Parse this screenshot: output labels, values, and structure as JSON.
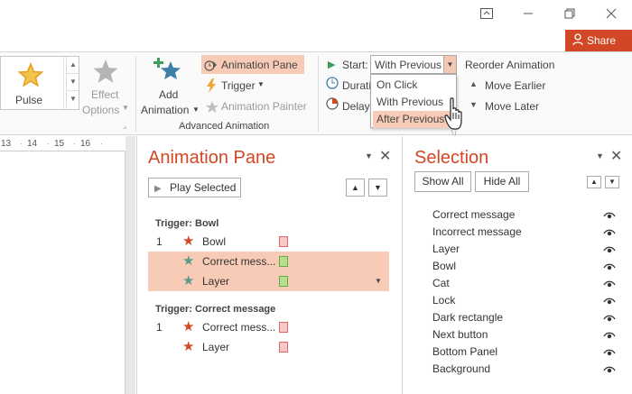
{
  "window": {
    "share_label": "Share",
    "colors": {
      "accent": "#d24726",
      "highlight": "#f8cbb6"
    }
  },
  "ribbon": {
    "gallery": {
      "selected_effect": "Pulse"
    },
    "effect_options": {
      "line1": "Effect",
      "line2": "Options"
    },
    "add_animation": {
      "line1": "Add",
      "line2": "Animation"
    },
    "animation_pane_btn": "Animation Pane",
    "trigger_btn": "Trigger",
    "animation_painter_btn": "Animation Painter",
    "group_label": "Advanced Animation",
    "start_label": "Start:",
    "duration_label": "Duratio",
    "delay_label": "Delay:",
    "start_value": "With Previous",
    "start_options": [
      "On Click",
      "With Previous",
      "After Previous"
    ],
    "reorder_label": "Reorder Animation",
    "move_earlier": "Move Earlier",
    "move_later": "Move Later"
  },
  "ruler": {
    "ticks": [
      "13",
      "14",
      "15",
      "16"
    ]
  },
  "animation_pane": {
    "title": "Animation Pane",
    "play_selected": "Play Selected",
    "groups": [
      {
        "trigger": "Trigger: Bowl",
        "items": [
          {
            "num": "1",
            "name": "Bowl",
            "star": "#d24726",
            "box": "red"
          },
          {
            "num": "",
            "name": "Correct mess...",
            "star": "#5a9a88",
            "box": "green"
          },
          {
            "num": "",
            "name": "Layer",
            "star": "#5a9a88",
            "box": "green"
          }
        ]
      },
      {
        "trigger": "Trigger: Correct message",
        "items": [
          {
            "num": "1",
            "name": "Correct mess...",
            "star": "#d24726",
            "box": "red"
          },
          {
            "num": "",
            "name": "Layer",
            "star": "#d24726",
            "box": "red"
          }
        ]
      }
    ]
  },
  "selection_pane": {
    "title": "Selection",
    "show_all": "Show All",
    "hide_all": "Hide All",
    "items": [
      "Correct message",
      "Incorrect message",
      "Layer",
      "Bowl",
      "Cat",
      "Lock",
      "Dark rectangle",
      "Next button",
      "Bottom Panel",
      "Background"
    ]
  }
}
